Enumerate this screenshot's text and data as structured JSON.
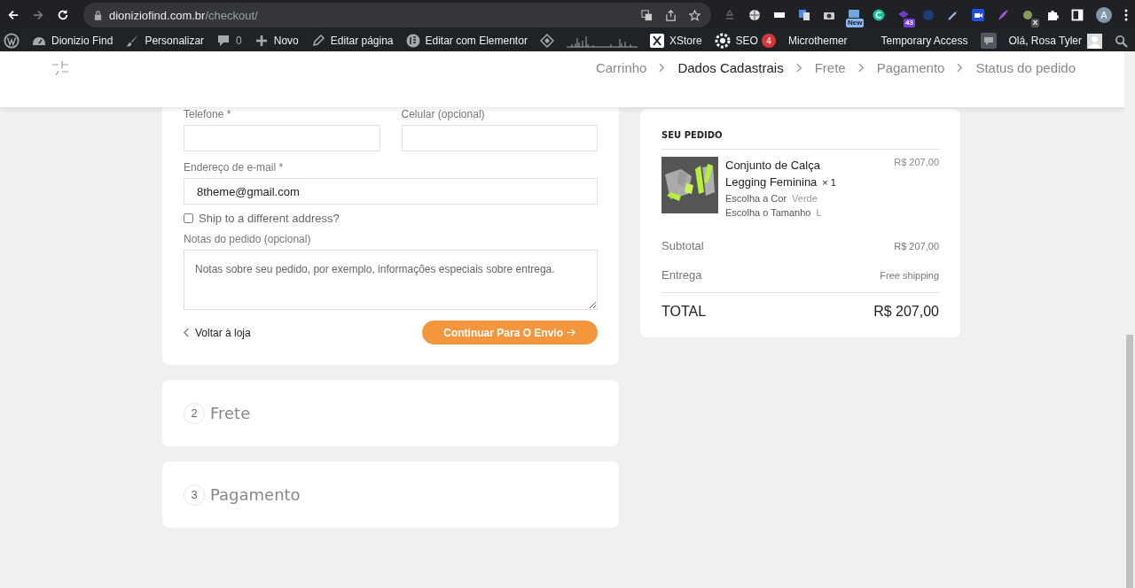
{
  "browser": {
    "forward_disabled": true,
    "url_domain": "dioniziofind.com.br",
    "url_path": "/checkout/",
    "extension_badges": [
      {
        "text": "New",
        "kind": "new"
      },
      {
        "text": "43",
        "kind": "count"
      },
      {
        "text": "X",
        "kind": "x"
      }
    ],
    "profile_initial": "A"
  },
  "admin_bar": {
    "left": [
      {
        "kind": "wp"
      },
      {
        "kind": "site",
        "label": "Dionizio Find"
      },
      {
        "kind": "brush",
        "label": "Personalizar"
      },
      {
        "kind": "comments",
        "label": "0"
      },
      {
        "kind": "plus",
        "label": "Novo"
      },
      {
        "kind": "pencil",
        "label": "Editar página"
      },
      {
        "kind": "elementor",
        "label": "Editar com Elementor"
      },
      {
        "kind": "diamond"
      },
      {
        "kind": "graph"
      },
      {
        "kind": "xstore",
        "label": "XStore"
      },
      {
        "kind": "seo",
        "label": "SEO",
        "badge": "4"
      },
      {
        "kind": "plain",
        "label": "Microthemer"
      }
    ],
    "right": [
      {
        "kind": "plain",
        "label": "Temporary Access"
      },
      {
        "kind": "comment-box"
      },
      {
        "kind": "user",
        "label": "Olá, Rosa Tyler"
      },
      {
        "kind": "search"
      }
    ]
  },
  "steps": [
    {
      "label": "Carrinho",
      "selected": false
    },
    {
      "label": "Dados Cadastrais",
      "selected": true
    },
    {
      "label": "Frete",
      "selected": false
    },
    {
      "label": "Pagamento",
      "selected": false
    },
    {
      "label": "Status do pedido",
      "selected": false
    }
  ],
  "form": {
    "phone": {
      "label": "Telefone *"
    },
    "mobile": {
      "label": "Celular (opcional)"
    },
    "email": {
      "label": "Endereço de e-mail *",
      "value": "8theme@gmail.com"
    },
    "ship_different": {
      "label": "Ship to a different address?",
      "checked": false
    },
    "notes": {
      "label": "Notas do pedido (opcional)",
      "placeholder": "Notas sobre seu pedido, por exemplo, informações especiais sobre entrega."
    },
    "back_link": "Voltar à loja",
    "continue_button": "Continuar Para O Envio"
  },
  "order": {
    "title": "SEU PEDIDO",
    "items": [
      {
        "kind": "picture",
        "name": "Conjunto de Calça Legging Feminina",
        "quantity": "× 1",
        "price": "R$ 207,00",
        "attributes": [
          {
            "label": "Escolha a Cor",
            "value": "Verde"
          },
          {
            "label": "Escolha o Tamanho",
            "value": "L"
          }
        ]
      }
    ],
    "subtotal": {
      "label": "Subtotal",
      "value": "R$ 207,00"
    },
    "shipping": {
      "label": "Entrega",
      "value": "Free shipping"
    },
    "total": {
      "label": "TOTAL",
      "value": "R$ 207,00"
    }
  },
  "sections": [
    {
      "number": "2",
      "title": "Frete"
    },
    {
      "number": "3",
      "title": "Pagamento"
    }
  ]
}
